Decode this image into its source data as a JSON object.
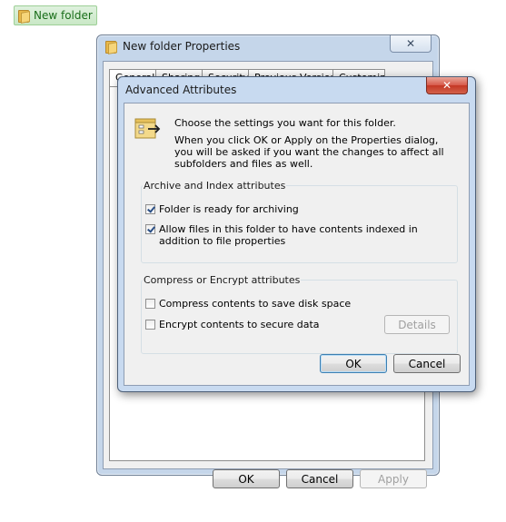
{
  "desktop": {
    "folder_label": "New folder"
  },
  "properties_window": {
    "title": "New folder Properties",
    "close_glyph": "✕",
    "tabs": [
      "General",
      "Sharing",
      "Security",
      "Previous Versions",
      "Customize"
    ],
    "ok_label": "OK",
    "cancel_label": "Cancel",
    "apply_label": "Apply"
  },
  "advanced_dialog": {
    "title": "Advanced Attributes",
    "close_glyph": "✕",
    "intro": "Choose the settings you want for this folder.",
    "description": "When you click OK or Apply on the Properties dialog, you will be asked if you want the changes to affect all subfolders and files as well.",
    "archive_group": {
      "label": "Archive and Index attributes",
      "items": [
        {
          "label": "Folder is ready for archiving",
          "checked": true
        },
        {
          "label": "Allow files in this folder to have contents indexed in addition to file properties",
          "checked": true
        }
      ]
    },
    "compress_group": {
      "label": "Compress or Encrypt attributes",
      "items": [
        {
          "label": "Compress contents to save disk space",
          "checked": false
        },
        {
          "label": "Encrypt contents to secure data",
          "checked": false
        }
      ],
      "details_label": "Details"
    },
    "ok_label": "OK",
    "cancel_label": "Cancel"
  },
  "colors": {
    "window_frame": "#c5d6ea",
    "close_red": "#c43725",
    "folder_yellow": "#e8b84a",
    "checkmark": "#2a4f86"
  },
  "icons": [
    "folder-icon",
    "close-icon",
    "attributes-icon"
  ]
}
